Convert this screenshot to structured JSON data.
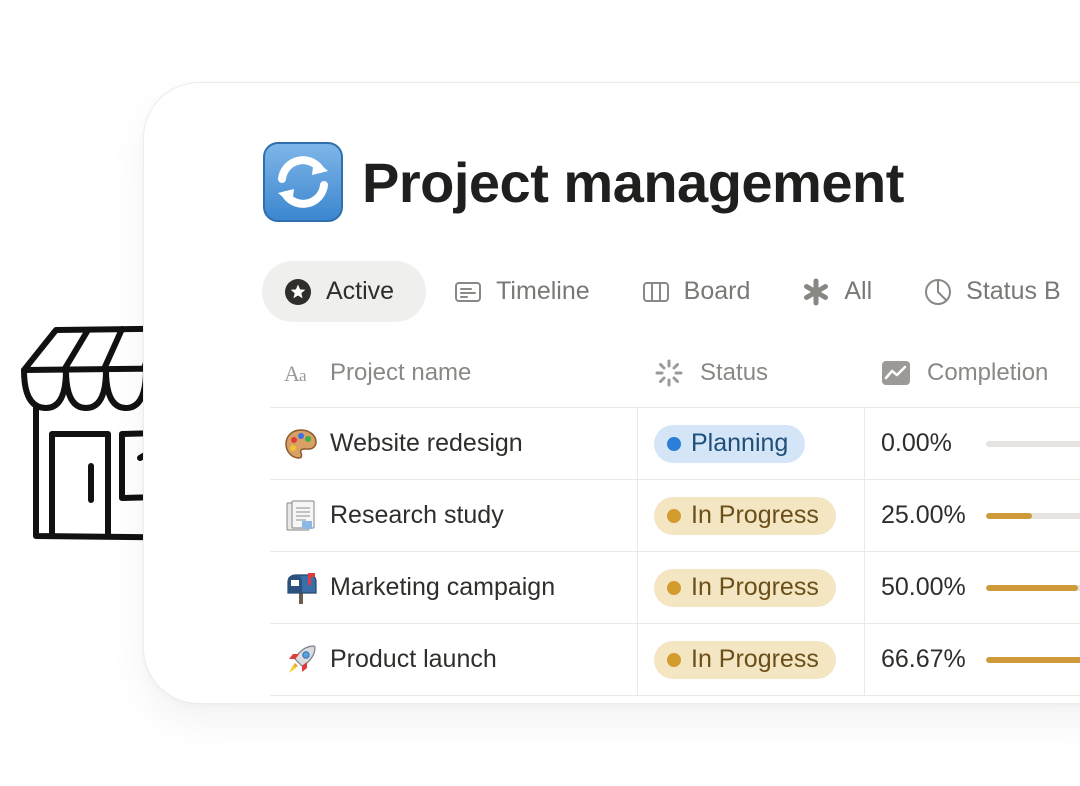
{
  "page": {
    "title": "Project management"
  },
  "tabs": [
    {
      "label": "Active",
      "icon": "star-circle-icon",
      "active": true
    },
    {
      "label": "Timeline",
      "icon": "timeline-icon",
      "active": false
    },
    {
      "label": "Board",
      "icon": "board-columns-icon",
      "active": false
    },
    {
      "label": "All",
      "icon": "asterisk-icon",
      "active": false
    },
    {
      "label": "Status B",
      "icon": "pie-chart-icon",
      "active": false
    }
  ],
  "table": {
    "headers": {
      "name": "Project name",
      "status": "Status",
      "completion": "Completion"
    },
    "rows": [
      {
        "name": "Website redesign",
        "emoji": "palette-icon",
        "status": "Planning",
        "status_kind": "planning",
        "completion_text": "0.00%",
        "completion": 0.0
      },
      {
        "name": "Research study",
        "emoji": "document-icon",
        "status": "In Progress",
        "status_kind": "progress",
        "completion_text": "25.00%",
        "completion": 0.25
      },
      {
        "name": "Marketing campaign",
        "emoji": "mailbox-icon",
        "status": "In Progress",
        "status_kind": "progress",
        "completion_text": "50.00%",
        "completion": 0.5
      },
      {
        "name": "Product launch",
        "emoji": "rocket-icon",
        "status": "In Progress",
        "status_kind": "progress",
        "completion_text": "66.67%",
        "completion": 0.6667
      }
    ]
  },
  "colors": {
    "planning_bg": "#d3e5f7",
    "planning_text": "#1f4e79",
    "planning_dot": "#2b7fd6",
    "progress_bg": "#f4e5c3",
    "progress_text": "#6b4f1a",
    "progress_dot": "#d29d2e",
    "bar_fill": "#cf9a3a",
    "bar_track": "#e5e4e1"
  }
}
